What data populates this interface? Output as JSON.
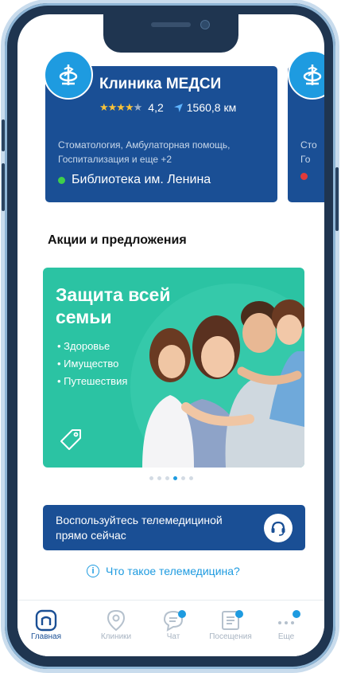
{
  "clinics": [
    {
      "name": "Клиника МЕДСИ",
      "rating": "4,2",
      "rating_value": 4.2,
      "distance": "1560,8 км",
      "services": "Стоматология, Амбулаторная помощь, Госпитализация и еще +2",
      "location": "Библиотека им. Ленина",
      "status_color": "#3ecf4a"
    },
    {
      "services_partial": "Сто\nГо",
      "status_color": "#e23a3a"
    }
  ],
  "promotions": {
    "section_title": "Акции и предложения",
    "banner": {
      "title": "Защита всей семьи",
      "items": [
        "Здоровье",
        "Имущество",
        "Путешествия"
      ]
    },
    "pagination": {
      "count": 6,
      "active_index": 3
    }
  },
  "telemedicine": {
    "banner_text": "Воспользуйтесь телемедициной прямо сейчас",
    "link_text": "Что такое телемедицина?"
  },
  "tabbar": {
    "items": [
      {
        "label": "Главная",
        "icon": "home-icon",
        "active": true,
        "badge": false
      },
      {
        "label": "Клиники",
        "icon": "map-pin-icon",
        "active": false,
        "badge": false
      },
      {
        "label": "Чат",
        "icon": "chat-icon",
        "active": false,
        "badge": true
      },
      {
        "label": "Посещения",
        "icon": "list-icon",
        "active": false,
        "badge": true
      },
      {
        "label": "Еще",
        "icon": "more-icon",
        "active": false,
        "badge": true
      }
    ]
  },
  "colors": {
    "primary": "#1a4f95",
    "accent": "#1e9be0",
    "promo_bg": "#2bc3a3",
    "star": "#f7c23a"
  }
}
